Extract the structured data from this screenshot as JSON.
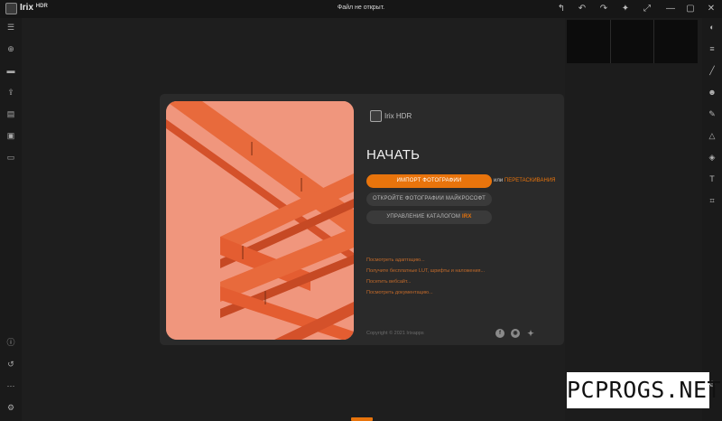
{
  "app": {
    "name": "Irix",
    "name_sup": "HDR",
    "doc_title": "Файл не открыт."
  },
  "titlebar_buttons": [
    {
      "icon": "share-icon",
      "glyph": "↰"
    },
    {
      "icon": "undo-icon",
      "glyph": "↶"
    },
    {
      "icon": "redo-icon",
      "glyph": "↷"
    },
    {
      "icon": "magic-wand-icon",
      "glyph": "✦"
    },
    {
      "icon": "fullscreen-icon",
      "glyph": "⤢"
    },
    {
      "icon": "minimize-icon",
      "glyph": "—"
    },
    {
      "icon": "maximize-icon",
      "glyph": "▢"
    },
    {
      "icon": "close-icon",
      "glyph": "✕"
    }
  ],
  "left_toolbar": [
    {
      "icon": "menu-icon",
      "glyph": "☰"
    },
    {
      "icon": "add-icon",
      "glyph": "⊕"
    },
    {
      "icon": "folder-icon",
      "glyph": "▬"
    },
    {
      "icon": "export-icon",
      "glyph": "⇪"
    },
    {
      "icon": "batch-icon",
      "glyph": "▤"
    },
    {
      "icon": "browser-icon",
      "glyph": "▣"
    },
    {
      "icon": "panorama-icon",
      "glyph": "▭"
    }
  ],
  "left_toolbar_bottom": [
    {
      "icon": "info-icon",
      "glyph": "ⓘ"
    },
    {
      "icon": "history-icon",
      "glyph": "↺"
    },
    {
      "icon": "more-icon",
      "glyph": "⋯"
    },
    {
      "icon": "settings-icon",
      "glyph": "⚙"
    }
  ],
  "right_toolbar": [
    {
      "icon": "color-icon",
      "glyph": "◐"
    },
    {
      "icon": "adjust-icon",
      "glyph": "≡"
    },
    {
      "icon": "brush-icon",
      "glyph": "╱"
    },
    {
      "icon": "face-icon",
      "glyph": "☻"
    },
    {
      "icon": "retouch-icon",
      "glyph": "✎"
    },
    {
      "icon": "gradient-icon",
      "glyph": "△"
    },
    {
      "icon": "layers-icon",
      "glyph": "◈"
    },
    {
      "icon": "text-icon",
      "glyph": "T"
    },
    {
      "icon": "crop-icon",
      "glyph": "⌗"
    }
  ],
  "right_toolbar_bottom": [
    {
      "icon": "settings-icon",
      "glyph": "⚙"
    }
  ],
  "dialog": {
    "brand": "Irix HDR",
    "heading": "НАЧАТЬ",
    "import_button": "ИМПОРТ ФОТОГРАФИИ",
    "or_text": "или",
    "drag_link": "ПЕРЕТАСКИВАНИЯ",
    "open_microsoft_button": "ОТКРОЙТЕ ФОТОГРАФИИ МАЙКРОСОФТ",
    "catalog_button_prefix": "УПРАВЛЕНИЕ КАТАЛОГОМ",
    "catalog_button_accent": "IRX",
    "links": [
      "Посмотреть адаптацию...",
      "Получите бесплатные LUT, шрифты и наложения...",
      "Посетить вебсайт...",
      "Посмотреть документацию..."
    ],
    "copyright": "Copyright © 2021 Irixapps",
    "social": [
      {
        "icon": "facebook-icon",
        "glyph": "f"
      },
      {
        "icon": "instagram-icon",
        "glyph": "◉"
      },
      {
        "icon": "twitter-icon",
        "glyph": "✦"
      }
    ]
  },
  "watermark": "PCPROGS.NET",
  "colors": {
    "accent": "#e8740c",
    "background": "#1e1e1e",
    "dialog": "#2a2a2a",
    "hero_wall": "#f0967d",
    "hero_stairs": "#e0582a"
  }
}
